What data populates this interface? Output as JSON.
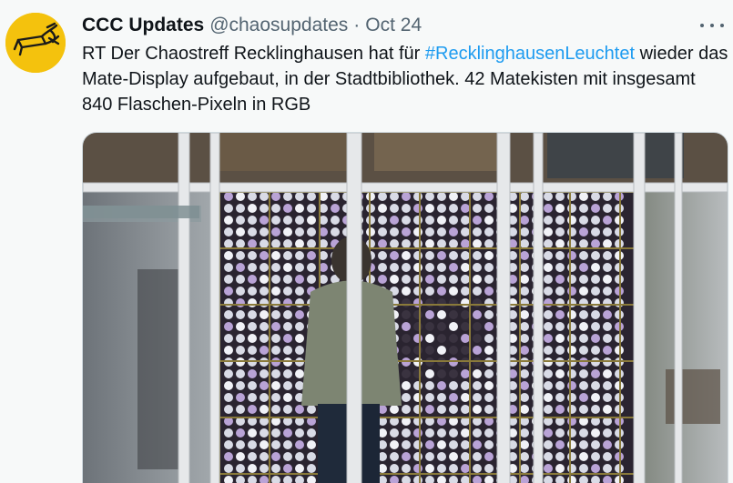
{
  "tweet": {
    "display_name": "CCC Updates",
    "handle": "@chaosupdates",
    "separator": "·",
    "date": "Oct 24",
    "text_before": "RT Der Chaostreff Recklinghausen hat für ",
    "hashtag": "#RecklinghausenLeuchtet",
    "text_after": " wieder das Mate-Display aufgebaut, in der Stadtbibliothek. 42 Matekisten mit insgesamt 840 Flaschen-Pixeln in RGB"
  },
  "icons": {
    "avatar": "ccc-logo",
    "more": "more-horizontal-icon"
  },
  "colors": {
    "link": "#1d9bf0",
    "secondary_text": "#536471",
    "avatar_bg": "#f4c20d"
  }
}
